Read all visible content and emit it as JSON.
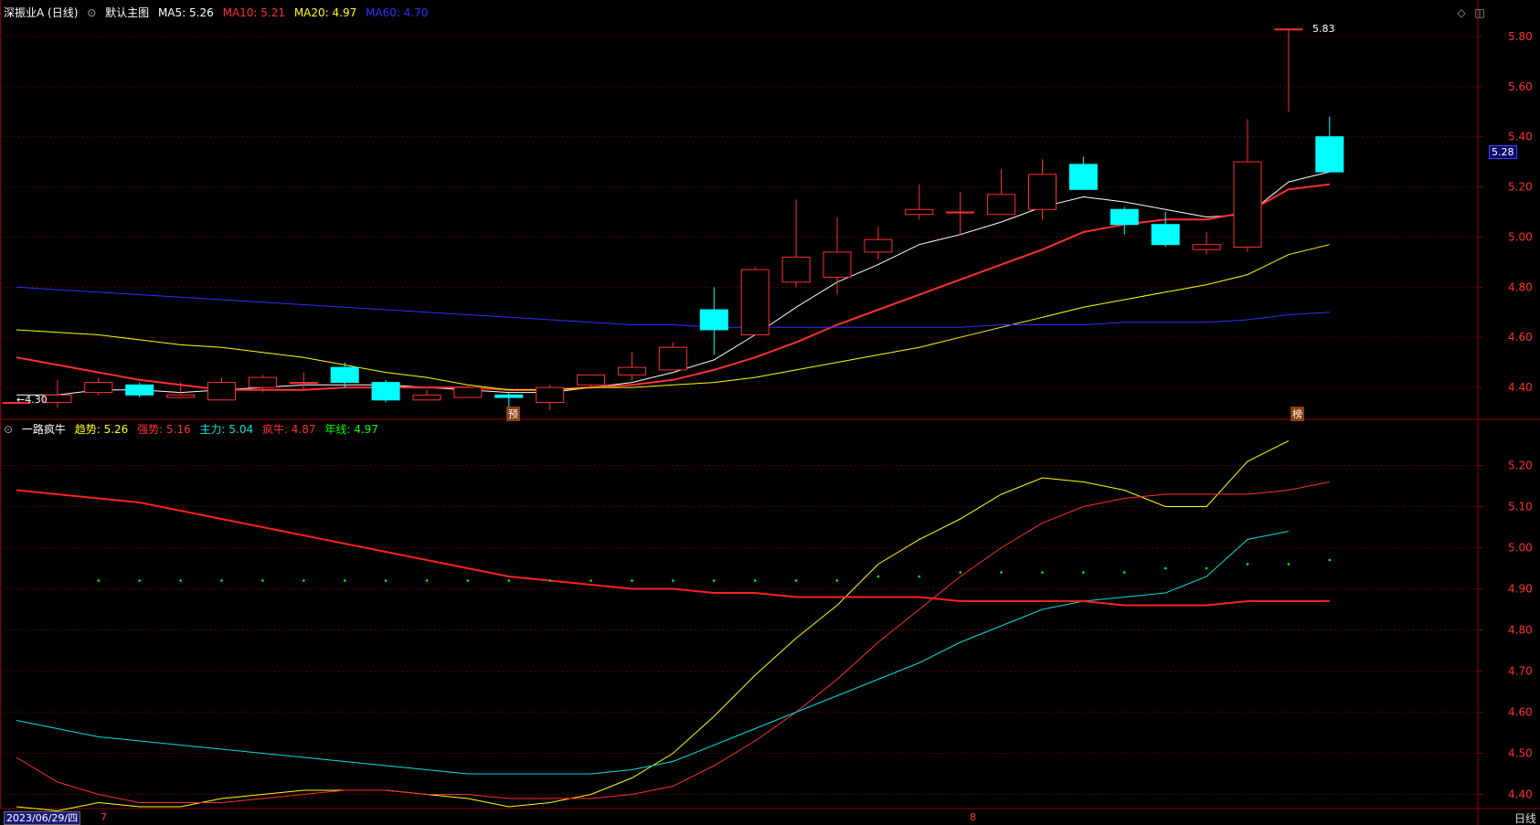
{
  "header_top": {
    "stock": "深振业A (日线)",
    "indicator_menu": "默认主图",
    "ma": [
      {
        "label": "MA5: 5.26",
        "color": "#ffffff"
      },
      {
        "label": "MA10: 5.21",
        "color": "#ff3030"
      },
      {
        "label": "MA20: 4.97",
        "color": "#ffff00"
      },
      {
        "label": "MA60: 4.70",
        "color": "#3030ff"
      }
    ]
  },
  "header_bottom": {
    "name": "一路疯牛",
    "items": [
      {
        "label": "趋势: 5.26",
        "color": "#ffff00"
      },
      {
        "label": "强势: 5.16",
        "color": "#ff3030"
      },
      {
        "label": "主力: 5.04",
        "color": "#00e0e0"
      },
      {
        "label": "疯牛: 4.87",
        "color": "#ff3030"
      },
      {
        "label": "年线: 4.97",
        "color": "#00ff00"
      }
    ]
  },
  "annotations": {
    "high_label": "5.83",
    "low_label": "←4.30",
    "current_price": "5.28",
    "marker_yu": "预",
    "marker_bang": "榜"
  },
  "footer": {
    "date": "2023/06/29/四",
    "month_7": "7",
    "month_8": "8",
    "period": "日线"
  },
  "chart_data": [
    {
      "type": "candlestick",
      "title": "深振业A (日线)",
      "y_ticks": [
        "5.80",
        "5.60",
        "5.40",
        "5.20",
        "5.00",
        "4.80",
        "4.60",
        "4.40"
      ],
      "ylim": [
        4.28,
        5.88
      ],
      "candles": [
        {
          "o": 4.34,
          "h": 4.34,
          "l": 4.34,
          "c": 4.34
        },
        {
          "o": 4.34,
          "h": 4.43,
          "l": 4.32,
          "c": 4.37
        },
        {
          "o": 4.38,
          "h": 4.44,
          "l": 4.37,
          "c": 4.42
        },
        {
          "o": 4.41,
          "h": 4.42,
          "l": 4.36,
          "c": 4.37
        },
        {
          "o": 4.36,
          "h": 4.42,
          "l": 4.36,
          "c": 4.37
        },
        {
          "o": 4.35,
          "h": 4.44,
          "l": 4.35,
          "c": 4.42
        },
        {
          "o": 4.4,
          "h": 4.45,
          "l": 4.38,
          "c": 4.44
        },
        {
          "o": 4.42,
          "h": 4.46,
          "l": 4.39,
          "c": 4.42
        },
        {
          "o": 4.48,
          "h": 4.5,
          "l": 4.4,
          "c": 4.42
        },
        {
          "o": 4.42,
          "h": 4.43,
          "l": 4.34,
          "c": 4.35
        },
        {
          "o": 4.35,
          "h": 4.39,
          "l": 4.35,
          "c": 4.37
        },
        {
          "o": 4.36,
          "h": 4.41,
          "l": 4.36,
          "c": 4.4
        },
        {
          "o": 4.37,
          "h": 4.38,
          "l": 4.31,
          "c": 4.36
        },
        {
          "o": 4.34,
          "h": 4.41,
          "l": 4.31,
          "c": 4.4
        },
        {
          "o": 4.41,
          "h": 4.45,
          "l": 4.4,
          "c": 4.45
        },
        {
          "o": 4.45,
          "h": 4.54,
          "l": 4.43,
          "c": 4.48
        },
        {
          "o": 4.47,
          "h": 4.58,
          "l": 4.47,
          "c": 4.56
        },
        {
          "o": 4.71,
          "h": 4.8,
          "l": 4.53,
          "c": 4.63
        },
        {
          "o": 4.61,
          "h": 4.88,
          "l": 4.61,
          "c": 4.87
        },
        {
          "o": 4.82,
          "h": 5.15,
          "l": 4.8,
          "c": 4.92
        },
        {
          "o": 4.84,
          "h": 5.08,
          "l": 4.77,
          "c": 4.94
        },
        {
          "o": 4.94,
          "h": 5.04,
          "l": 4.91,
          "c": 4.99
        },
        {
          "o": 5.09,
          "h": 5.21,
          "l": 5.07,
          "c": 5.11
        },
        {
          "o": 5.1,
          "h": 5.18,
          "l": 5.01,
          "c": 5.1
        },
        {
          "o": 5.09,
          "h": 5.27,
          "l": 5.09,
          "c": 5.17
        },
        {
          "o": 5.11,
          "h": 5.31,
          "l": 5.07,
          "c": 5.25
        },
        {
          "o": 5.29,
          "h": 5.32,
          "l": 5.19,
          "c": 5.19
        },
        {
          "o": 5.11,
          "h": 5.12,
          "l": 5.01,
          "c": 5.05
        },
        {
          "o": 5.05,
          "h": 5.1,
          "l": 4.96,
          "c": 4.97
        },
        {
          "o": 4.95,
          "h": 5.02,
          "l": 4.93,
          "c": 4.97
        },
        {
          "o": 4.96,
          "h": 5.47,
          "l": 4.94,
          "c": 5.3
        },
        {
          "o": 5.83,
          "h": 5.83,
          "l": 5.5,
          "c": 5.83
        },
        {
          "o": 5.4,
          "h": 5.48,
          "l": 5.26,
          "c": 5.26
        }
      ],
      "series": [
        {
          "name": "MA5",
          "color": "#ffffff",
          "values": [
            4.37,
            4.37,
            4.39,
            4.39,
            4.38,
            4.39,
            4.4,
            4.41,
            4.41,
            4.41,
            4.4,
            4.39,
            4.38,
            4.38,
            4.4,
            4.42,
            4.46,
            4.51,
            4.61,
            4.72,
            4.82,
            4.89,
            4.97,
            5.01,
            5.06,
            5.12,
            5.16,
            5.14,
            5.11,
            5.08,
            5.09,
            5.22,
            5.26
          ]
        },
        {
          "name": "MA10",
          "color": "#ff3030",
          "values": [
            4.52,
            4.49,
            4.46,
            4.43,
            4.41,
            4.39,
            4.39,
            4.39,
            4.4,
            4.4,
            4.4,
            4.4,
            4.39,
            4.39,
            4.4,
            4.41,
            4.43,
            4.47,
            4.52,
            4.58,
            4.65,
            4.71,
            4.77,
            4.83,
            4.89,
            4.95,
            5.02,
            5.05,
            5.07,
            5.07,
            5.1,
            5.19,
            5.21
          ]
        },
        {
          "name": "MA20",
          "color": "#ffff00",
          "values": [
            4.63,
            4.62,
            4.61,
            4.59,
            4.57,
            4.56,
            4.54,
            4.52,
            4.49,
            4.46,
            4.44,
            4.41,
            4.39,
            4.39,
            4.4,
            4.4,
            4.41,
            4.42,
            4.44,
            4.47,
            4.5,
            4.53,
            4.56,
            4.6,
            4.64,
            4.68,
            4.72,
            4.75,
            4.78,
            4.81,
            4.85,
            4.93,
            4.97
          ]
        },
        {
          "name": "MA60",
          "color": "#3030ff",
          "values": [
            4.8,
            4.79,
            4.78,
            4.77,
            4.76,
            4.75,
            4.74,
            4.73,
            4.72,
            4.71,
            4.7,
            4.69,
            4.68,
            4.67,
            4.66,
            4.65,
            4.65,
            4.64,
            4.64,
            4.64,
            4.64,
            4.64,
            4.64,
            4.64,
            4.65,
            4.65,
            4.65,
            4.66,
            4.66,
            4.66,
            4.67,
            4.69,
            4.7
          ]
        }
      ]
    },
    {
      "type": "line",
      "title": "一路疯牛",
      "y_ticks": [
        "5.20",
        "5.10",
        "5.00",
        "4.90",
        "4.80",
        "4.70",
        "4.60",
        "4.50",
        "4.40"
      ],
      "ylim": [
        4.37,
        5.27
      ],
      "series": [
        {
          "name": "趋势",
          "color": "#ffff00",
          "values": [
            4.37,
            4.36,
            4.38,
            4.37,
            4.37,
            4.39,
            4.4,
            4.41,
            4.41,
            4.41,
            4.4,
            4.39,
            4.37,
            4.38,
            4.4,
            4.44,
            4.5,
            4.59,
            4.69,
            4.78,
            4.86,
            4.96,
            5.02,
            5.07,
            5.13,
            5.17,
            5.16,
            5.14,
            5.1,
            5.1,
            5.21,
            5.26,
            null
          ]
        },
        {
          "name": "强势",
          "color": "#ff3030",
          "values": [
            4.49,
            4.43,
            4.4,
            4.38,
            4.38,
            4.38,
            4.39,
            4.4,
            4.41,
            4.41,
            4.4,
            4.4,
            4.39,
            4.39,
            4.39,
            4.4,
            4.42,
            4.47,
            4.53,
            4.6,
            4.68,
            4.77,
            4.85,
            4.93,
            5.0,
            5.06,
            5.1,
            5.12,
            5.13,
            5.13,
            5.13,
            5.14,
            5.16
          ]
        },
        {
          "name": "主力",
          "color": "#00e0e0",
          "values": [
            4.58,
            4.56,
            4.54,
            4.53,
            4.52,
            4.51,
            4.5,
            4.49,
            4.48,
            4.47,
            4.46,
            4.45,
            4.45,
            4.45,
            4.45,
            4.46,
            4.48,
            4.52,
            4.56,
            4.6,
            4.64,
            4.68,
            4.72,
            4.77,
            4.81,
            4.85,
            4.87,
            4.88,
            4.89,
            4.93,
            5.02,
            5.04,
            null
          ]
        },
        {
          "name": "疯牛",
          "color": "#ff2020",
          "values": [
            5.14,
            5.13,
            5.12,
            5.11,
            5.09,
            5.07,
            5.05,
            5.03,
            5.01,
            4.99,
            4.97,
            4.95,
            4.93,
            4.92,
            4.91,
            4.9,
            4.9,
            4.89,
            4.89,
            4.88,
            4.88,
            4.88,
            4.88,
            4.87,
            4.87,
            4.87,
            4.87,
            4.86,
            4.86,
            4.86,
            4.87,
            4.87,
            4.87
          ]
        },
        {
          "name": "年线",
          "color": "#00ff00",
          "values": [
            null,
            null,
            4.92,
            4.92,
            4.92,
            4.92,
            4.92,
            4.92,
            4.92,
            4.92,
            4.92,
            4.92,
            4.92,
            4.92,
            4.92,
            4.92,
            4.92,
            4.92,
            4.92,
            4.92,
            4.92,
            4.93,
            4.93,
            4.94,
            4.94,
            4.94,
            4.94,
            4.94,
            4.95,
            4.95,
            4.96,
            4.96,
            4.97
          ]
        }
      ]
    }
  ]
}
